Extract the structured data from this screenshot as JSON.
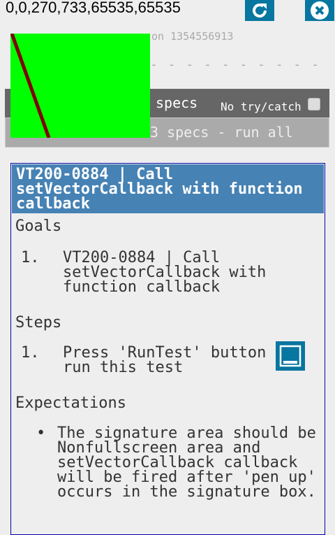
{
  "coords": "0,0,270,733,65535,65535",
  "version_visible": "on 1354556913",
  "dashes": "- - - - - - - - - -",
  "bar": {
    "specs_label": "specs",
    "no_try_catch": "No try/catch",
    "run_all": "3 specs - run all"
  },
  "spec": {
    "title": "VT200-0884 | Call setVectorCallback with function callback",
    "goals_heading": "Goals",
    "goals": [
      {
        "n": "1.",
        "text": "VT200-0884 | Call setVectorCallback with function callback"
      }
    ],
    "steps_heading": "Steps",
    "steps": [
      {
        "n": "1.",
        "text": "Press 'RunTest' button to run this test"
      }
    ],
    "expectations_heading": "Expectations",
    "expectations": [
      {
        "n": "•",
        "text": "The signature area should be Nonfullscreen area and setVectorCallback callback will be fired after 'pen up' occurs in the signature box."
      }
    ]
  },
  "colors": {
    "button": "#0776a0",
    "header": "#4682b4",
    "signature_bg": "#00ff00",
    "stroke": "#800000"
  }
}
